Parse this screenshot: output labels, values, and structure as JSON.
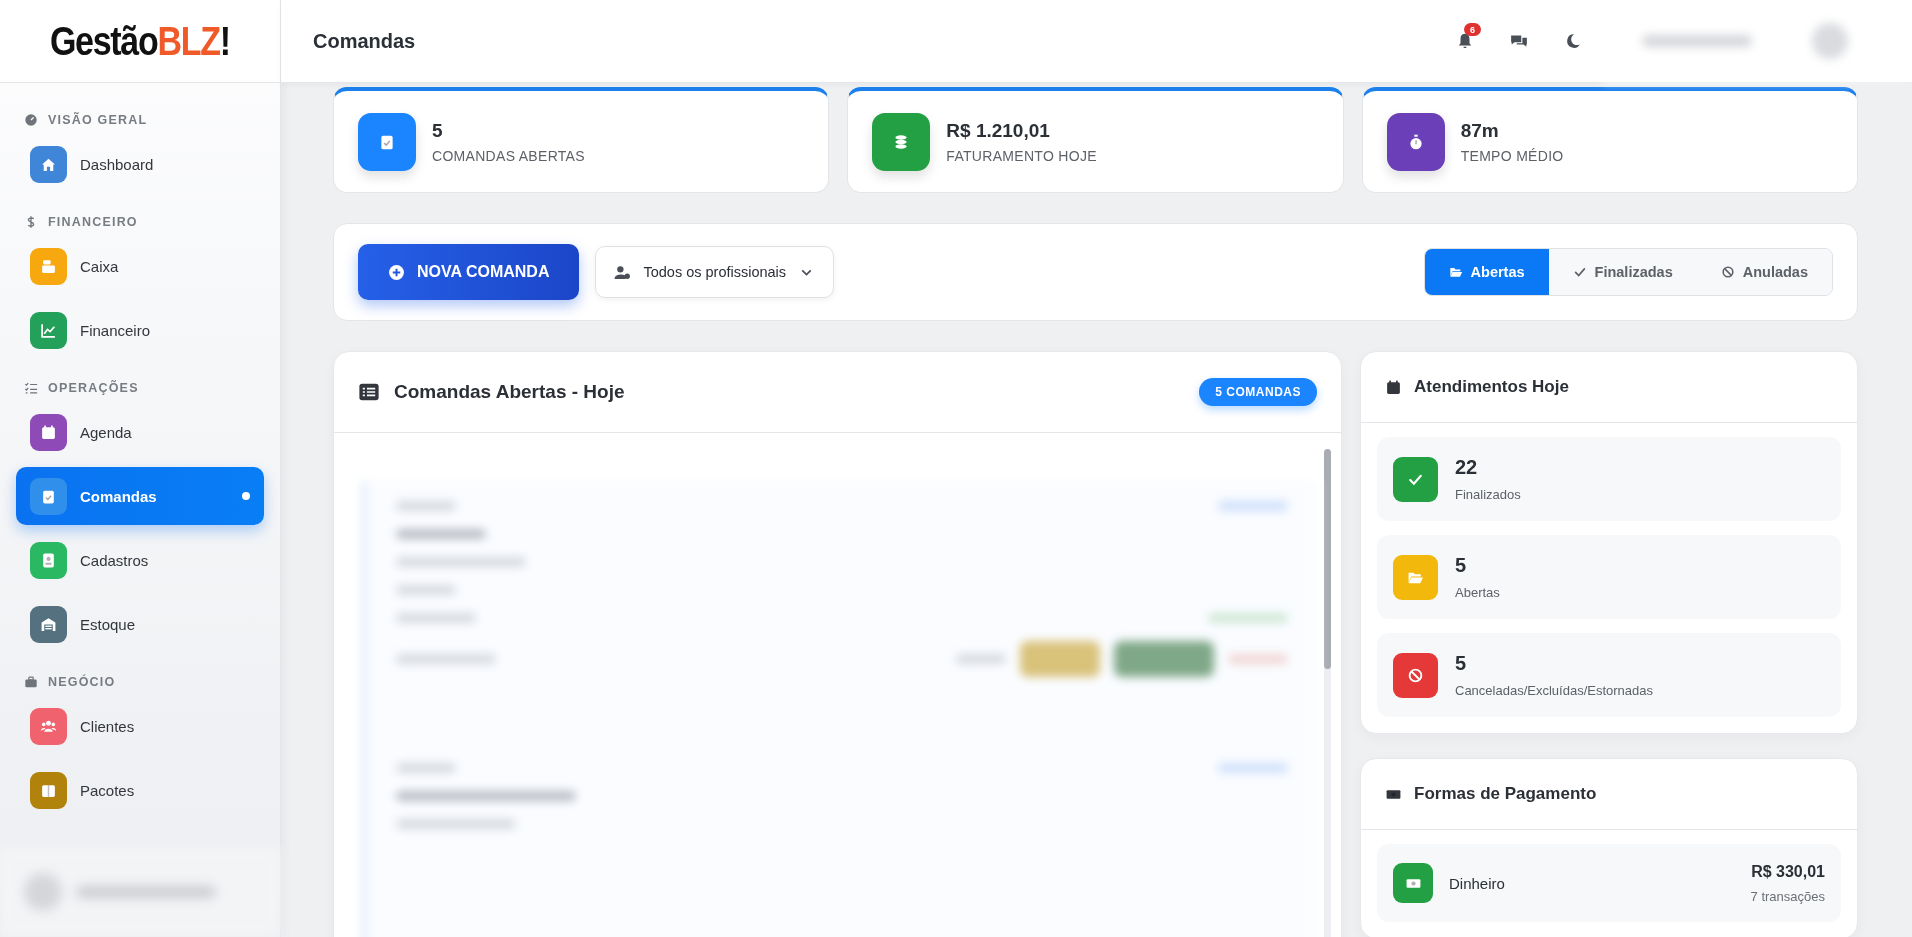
{
  "brand": {
    "text": "Gestão",
    "accent": "BLZ",
    "mark": "!"
  },
  "sidebar": {
    "sections": [
      {
        "title": "VISÃO GERAL",
        "kind": "gauge",
        "items": [
          {
            "label": "Dashboard",
            "kind": "home",
            "color": "#3f86d8",
            "selected": false
          }
        ]
      },
      {
        "title": "FINANCEIRO",
        "kind": "dollar",
        "items": [
          {
            "label": "Caixa",
            "kind": "register",
            "color": "#f7a80f",
            "selected": false
          },
          {
            "label": "Financeiro",
            "kind": "chart",
            "color": "#23a05a",
            "selected": false
          }
        ]
      },
      {
        "title": "OPERAÇÕES",
        "kind": "tasks",
        "items": [
          {
            "label": "Agenda",
            "kind": "calendar",
            "color": "#8e4bb8",
            "selected": false
          },
          {
            "label": "Comandas",
            "kind": "clipboard",
            "color": "#2f8fea",
            "selected": true
          },
          {
            "label": "Cadastros",
            "kind": "contact",
            "color": "#2bb863",
            "selected": false
          },
          {
            "label": "Estoque",
            "kind": "warehouse",
            "color": "#55707f",
            "selected": false
          }
        ]
      },
      {
        "title": "NEGÓCIO",
        "kind": "briefcase",
        "items": [
          {
            "label": "Clientes",
            "kind": "users",
            "color": "#f0626d",
            "selected": false
          },
          {
            "label": "Pacotes",
            "kind": "box",
            "color": "#b1820c",
            "selected": false
          }
        ]
      }
    ]
  },
  "topbar": {
    "title": "Comandas",
    "notifications": "6"
  },
  "stats": [
    {
      "value": "5",
      "label": "COMANDAS ABERTAS",
      "kind": "clipboard",
      "color": "#1b84ff"
    },
    {
      "value": "R$ 1.210,01",
      "label": "FATURAMENTO HOJE",
      "kind": "coins",
      "color": "#23a043"
    },
    {
      "value": "87m",
      "label": "TEMPO MÉDIO",
      "kind": "stopwatch",
      "color": "#6a3fb8"
    }
  ],
  "toolbar": {
    "new_button": "NOVA COMANDA",
    "filter": "Todos os profissionais",
    "tabs": [
      {
        "label": "Abertas",
        "kind": "folder",
        "selected": true
      },
      {
        "label": "Finalizadas",
        "kind": "check",
        "selected": false
      },
      {
        "label": "Anuladas",
        "kind": "ban",
        "selected": false
      }
    ]
  },
  "orders_panel": {
    "title": "Comandas Abertas - Hoje",
    "badge": "5 COMANDAS"
  },
  "attendance": {
    "title": "Atendimentos Hoje",
    "items": [
      {
        "value": "22",
        "label": "Finalizados",
        "kind": "check",
        "color": "#23a043"
      },
      {
        "value": "5",
        "label": "Abertas",
        "kind": "folder",
        "color": "#f2b90c"
      },
      {
        "value": "5",
        "label": "Canceladas/Excluídas/Estornadas",
        "kind": "ban",
        "color": "#e53838"
      }
    ]
  },
  "payments": {
    "title": "Formas de Pagamento",
    "items": [
      {
        "label": "Dinheiro",
        "amount": "R$ 330,01",
        "count": "7 transações",
        "kind": "cash",
        "color": "#23a043"
      }
    ]
  }
}
